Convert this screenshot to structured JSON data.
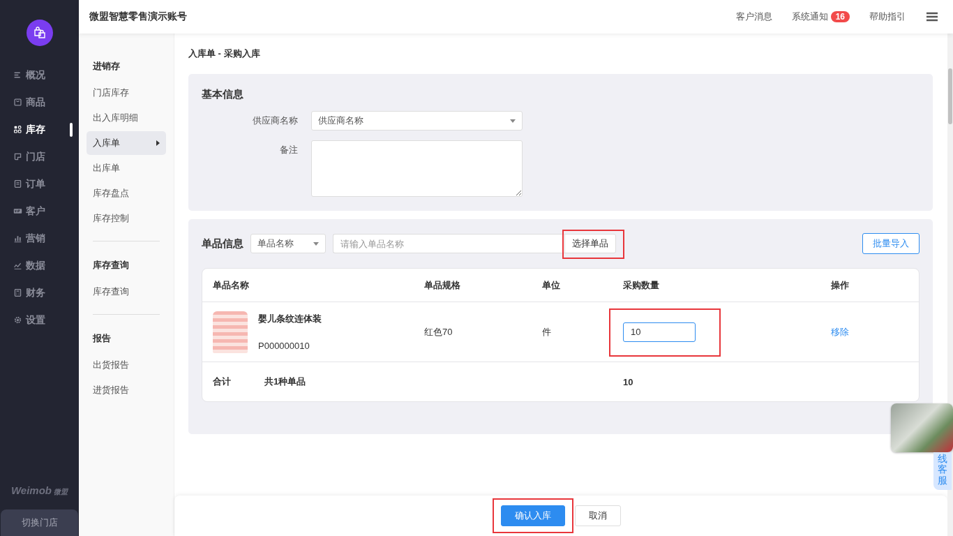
{
  "brand": {
    "name": "Weimob",
    "suffix": "微盟"
  },
  "nav": [
    {
      "label": "概况",
      "selected": false
    },
    {
      "label": "商品",
      "selected": false
    },
    {
      "label": "库存",
      "selected": true
    },
    {
      "label": "门店",
      "selected": false
    },
    {
      "label": "订单",
      "selected": false
    },
    {
      "label": "客户",
      "selected": false
    },
    {
      "label": "营销",
      "selected": false
    },
    {
      "label": "数据",
      "selected": false
    },
    {
      "label": "财务",
      "selected": false
    },
    {
      "label": "设置",
      "selected": false
    }
  ],
  "switch_store": "切换门店",
  "header": {
    "title": "微盟智慧零售演示账号",
    "links": [
      {
        "label": "客户消息"
      },
      {
        "label": "系统通知",
        "badge": "16"
      },
      {
        "label": "帮助指引"
      }
    ]
  },
  "subnav": [
    {
      "title": "进销存",
      "items": [
        {
          "label": "门店库存",
          "selected": false
        },
        {
          "label": "出入库明细",
          "selected": false
        },
        {
          "label": "入库单",
          "selected": true
        },
        {
          "label": "出库单",
          "selected": false
        },
        {
          "label": "库存盘点",
          "selected": false
        },
        {
          "label": "库存控制",
          "selected": false
        }
      ]
    },
    {
      "title": "库存查询",
      "items": [
        {
          "label": "库存查询",
          "selected": false
        }
      ]
    },
    {
      "title": "报告",
      "items": [
        {
          "label": "出货报告",
          "selected": false
        },
        {
          "label": "进货报告",
          "selected": false
        }
      ]
    }
  ],
  "page": {
    "title": "入库单 - 采购入库"
  },
  "basic": {
    "title": "基本信息",
    "fields": [
      {
        "kind": "select",
        "label": "供应商名称",
        "value": "供应商名称"
      },
      {
        "kind": "textarea",
        "label": "备注"
      }
    ]
  },
  "items": {
    "title": "单品信息",
    "filter": {
      "value": "单品名称"
    },
    "search": {
      "placeholder": "请输入单品名称"
    },
    "select_button": {
      "label": "选择单品",
      "highlighted": true
    },
    "import_button": {
      "label": "批量导入"
    },
    "columns": [
      "单品名称",
      "单品规格",
      "单位",
      "采购数量",
      "操作"
    ],
    "rows": [
      {
        "name": "婴儿条纹连体装",
        "code": "P000000010",
        "spec": "红色70",
        "unit": "件",
        "quantity": "10",
        "highlighted": true,
        "action": "移除"
      }
    ],
    "total": {
      "label": "合计",
      "count": "共1种单品",
      "quantity": "10"
    }
  },
  "footer": {
    "buttons": [
      {
        "label": "确认入库",
        "kind": "primary",
        "highlighted": true
      },
      {
        "label": "取消",
        "kind": "default",
        "highlighted": false
      }
    ]
  },
  "chat": {
    "label": "线客服"
  }
}
